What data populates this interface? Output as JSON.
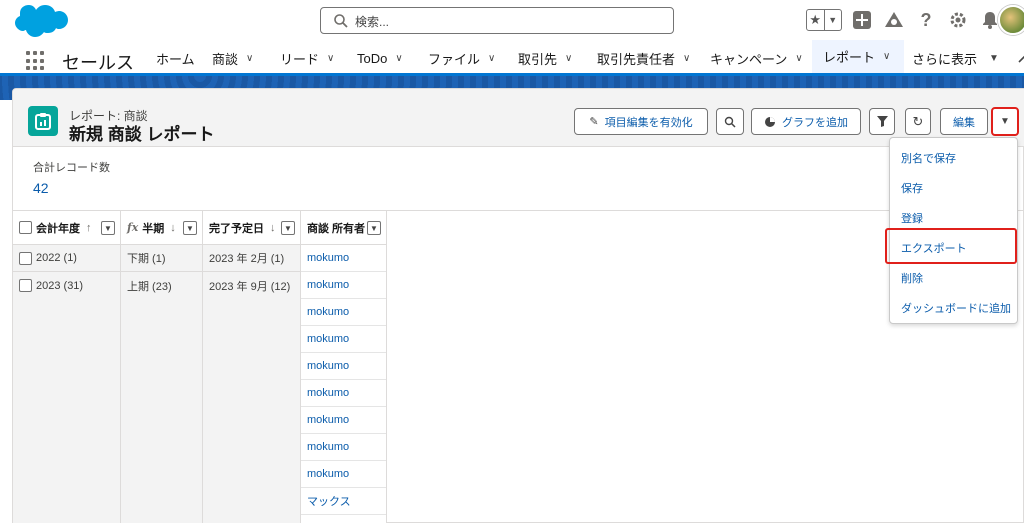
{
  "header": {
    "search_placeholder": "検索...",
    "icons": [
      "star-icon",
      "chevron-down-icon",
      "plus-icon",
      "trailhead-icon",
      "help-icon",
      "gear-icon",
      "bell-icon",
      "avatar"
    ]
  },
  "nav": {
    "app_name": "セールス",
    "items": [
      {
        "label": "ホーム",
        "dropdown": false
      },
      {
        "label": "商談",
        "dropdown": true
      },
      {
        "label": "リード",
        "dropdown": true
      },
      {
        "label": "ToDo",
        "dropdown": true
      },
      {
        "label": "ファイル",
        "dropdown": true
      },
      {
        "label": "取引先",
        "dropdown": true
      },
      {
        "label": "取引先責任者",
        "dropdown": true
      },
      {
        "label": "キャンペーン",
        "dropdown": true
      },
      {
        "label": "レポート",
        "dropdown": true,
        "active": true
      },
      {
        "label": "さらに表示",
        "dropdown": true
      }
    ]
  },
  "report": {
    "subtitle": "レポート: 商談",
    "title": "新規 商談 レポート",
    "buttons": {
      "inline_edit": "項目編集を有効化",
      "add_chart": "グラフを追加",
      "edit": "編集"
    },
    "summary_label": "合計レコード数",
    "summary_value": "42"
  },
  "table": {
    "headers": [
      "会計年度",
      "半期",
      "完了予定日",
      "商談 所有者"
    ],
    "sort_fy": "↑",
    "sort_half": "↓",
    "sort_close": "↓",
    "fx": "fx",
    "groups": [
      {
        "fiscal_year": "2022 (1)",
        "half": "下期 (1)",
        "close_date": "2023 年 2月 (1)"
      },
      {
        "fiscal_year": "2023 (31)",
        "half": "上期 (23)",
        "close_date": "2023 年 9月 (12)"
      }
    ],
    "owners": [
      "mokumo",
      "mokumo",
      "mokumo",
      "mokumo",
      "mokumo",
      "mokumo",
      "mokumo",
      "mokumo",
      "mokumo",
      "マックス",
      "mokumo"
    ]
  },
  "menu": {
    "items": [
      "別名で保存",
      "保存",
      "登録",
      "エクスポート",
      "削除",
      "ダッシュボードに追加"
    ]
  },
  "colors": {
    "brand_blue": "#0176d3",
    "link_blue": "#0b5cab",
    "report_icon": "#06a59a",
    "highlight_red": "#e0201b"
  }
}
